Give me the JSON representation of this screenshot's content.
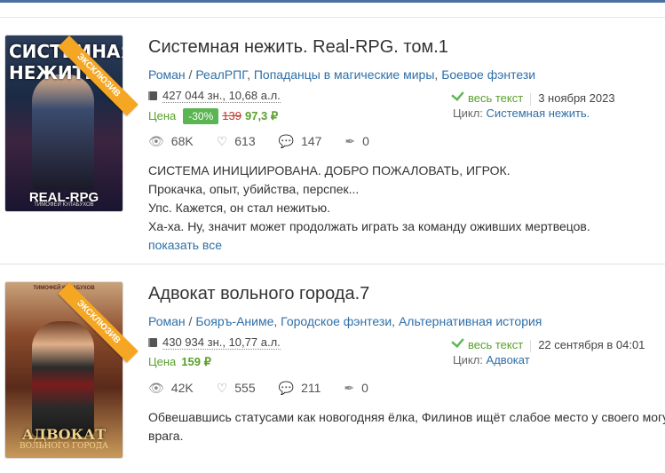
{
  "books": [
    {
      "cover": {
        "title": "СИСТЕМНАЯ НЕЖИТЬ",
        "subtitle": "REAL-RPG",
        "author": "ТИМОФЕЙ КУЛАБУХОВ"
      },
      "badge": "ЭКСКЛЮЗИВ",
      "title": "Системная нежить. Real-RPG. том.1",
      "genres": [
        "Роман",
        "РеалРПГ",
        "Попаданцы в магические миры",
        "Боевое фэнтези"
      ],
      "size": "427 044 зн., 10,68 а.л.",
      "price_label": "Цена",
      "discount": "-30%",
      "old_price": "139",
      "new_price": "97,3 ₽",
      "status": "весь текст",
      "date": "3 ноября 2023",
      "cycle_label": "Цикл:",
      "cycle": "Системная нежить.",
      "views": "68K",
      "likes": "613",
      "comments": "147",
      "rewards": "0",
      "description": [
        "СИСТЕМА ИНИЦИИРОВАНА. ДОБРО ПОЖАЛОВАТЬ, ИГРОК.",
        "Прокачка, опыт, убийства, перспек...",
        "Упс. Кажется, он стал нежитью.",
        "Ха-ха. Ну, значит может продолжать играть за команду оживших мертвецов."
      ],
      "show_all": "показать все"
    },
    {
      "cover": {
        "title": "АДВОКАТ",
        "subtitle2": "ВОЛЬНОГО ГОРОДА",
        "numeral": "VII",
        "author": "ТИМОФЕЙ КУЛАБУХОВ"
      },
      "badge": "ЭКСКЛЮЗИВ",
      "title": "Адвокат вольного города.7",
      "genres": [
        "Роман",
        "Бояръ-Аниме",
        "Городское фэнтези",
        "Альтернативная история"
      ],
      "size": "430 934 зн., 10,77 а.л.",
      "price_label": "Цена",
      "new_price": "159 ₽",
      "status": "весь текст",
      "date": "22 сентября в 04:01",
      "cycle_label": "Цикл:",
      "cycle": "Адвокат",
      "views": "42K",
      "likes": "555",
      "comments": "211",
      "rewards": "0",
      "description": [
        "Обвешавшись статусами как новогодняя ёлка, Филинов ищёт слабое место у своего могу",
        "врага."
      ]
    }
  ],
  "colors": {
    "link": "#2f6fa8",
    "price_green": "#5aa02c",
    "badge_orange": "#f5a623",
    "old_price_red": "#c0392b"
  }
}
